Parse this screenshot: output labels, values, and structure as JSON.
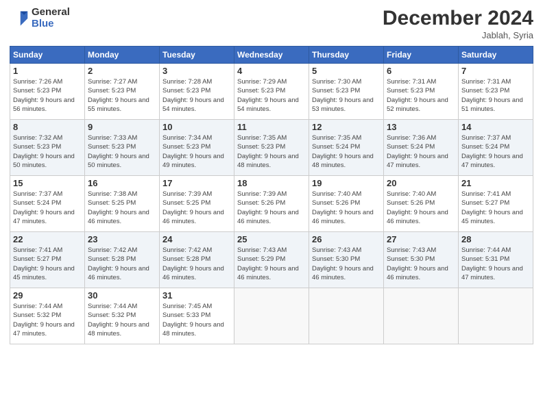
{
  "logo": {
    "line1": "General",
    "line2": "Blue"
  },
  "title": "December 2024",
  "subtitle": "Jablah, Syria",
  "days_header": [
    "Sunday",
    "Monday",
    "Tuesday",
    "Wednesday",
    "Thursday",
    "Friday",
    "Saturday"
  ],
  "weeks": [
    [
      {
        "num": "1",
        "sunrise": "Sunrise: 7:26 AM",
        "sunset": "Sunset: 5:23 PM",
        "daylight": "Daylight: 9 hours and 56 minutes."
      },
      {
        "num": "2",
        "sunrise": "Sunrise: 7:27 AM",
        "sunset": "Sunset: 5:23 PM",
        "daylight": "Daylight: 9 hours and 55 minutes."
      },
      {
        "num": "3",
        "sunrise": "Sunrise: 7:28 AM",
        "sunset": "Sunset: 5:23 PM",
        "daylight": "Daylight: 9 hours and 54 minutes."
      },
      {
        "num": "4",
        "sunrise": "Sunrise: 7:29 AM",
        "sunset": "Sunset: 5:23 PM",
        "daylight": "Daylight: 9 hours and 54 minutes."
      },
      {
        "num": "5",
        "sunrise": "Sunrise: 7:30 AM",
        "sunset": "Sunset: 5:23 PM",
        "daylight": "Daylight: 9 hours and 53 minutes."
      },
      {
        "num": "6",
        "sunrise": "Sunrise: 7:31 AM",
        "sunset": "Sunset: 5:23 PM",
        "daylight": "Daylight: 9 hours and 52 minutes."
      },
      {
        "num": "7",
        "sunrise": "Sunrise: 7:31 AM",
        "sunset": "Sunset: 5:23 PM",
        "daylight": "Daylight: 9 hours and 51 minutes."
      }
    ],
    [
      {
        "num": "8",
        "sunrise": "Sunrise: 7:32 AM",
        "sunset": "Sunset: 5:23 PM",
        "daylight": "Daylight: 9 hours and 50 minutes."
      },
      {
        "num": "9",
        "sunrise": "Sunrise: 7:33 AM",
        "sunset": "Sunset: 5:23 PM",
        "daylight": "Daylight: 9 hours and 50 minutes."
      },
      {
        "num": "10",
        "sunrise": "Sunrise: 7:34 AM",
        "sunset": "Sunset: 5:23 PM",
        "daylight": "Daylight: 9 hours and 49 minutes."
      },
      {
        "num": "11",
        "sunrise": "Sunrise: 7:35 AM",
        "sunset": "Sunset: 5:23 PM",
        "daylight": "Daylight: 9 hours and 48 minutes."
      },
      {
        "num": "12",
        "sunrise": "Sunrise: 7:35 AM",
        "sunset": "Sunset: 5:24 PM",
        "daylight": "Daylight: 9 hours and 48 minutes."
      },
      {
        "num": "13",
        "sunrise": "Sunrise: 7:36 AM",
        "sunset": "Sunset: 5:24 PM",
        "daylight": "Daylight: 9 hours and 47 minutes."
      },
      {
        "num": "14",
        "sunrise": "Sunrise: 7:37 AM",
        "sunset": "Sunset: 5:24 PM",
        "daylight": "Daylight: 9 hours and 47 minutes."
      }
    ],
    [
      {
        "num": "15",
        "sunrise": "Sunrise: 7:37 AM",
        "sunset": "Sunset: 5:24 PM",
        "daylight": "Daylight: 9 hours and 47 minutes."
      },
      {
        "num": "16",
        "sunrise": "Sunrise: 7:38 AM",
        "sunset": "Sunset: 5:25 PM",
        "daylight": "Daylight: 9 hours and 46 minutes."
      },
      {
        "num": "17",
        "sunrise": "Sunrise: 7:39 AM",
        "sunset": "Sunset: 5:25 PM",
        "daylight": "Daylight: 9 hours and 46 minutes."
      },
      {
        "num": "18",
        "sunrise": "Sunrise: 7:39 AM",
        "sunset": "Sunset: 5:26 PM",
        "daylight": "Daylight: 9 hours and 46 minutes."
      },
      {
        "num": "19",
        "sunrise": "Sunrise: 7:40 AM",
        "sunset": "Sunset: 5:26 PM",
        "daylight": "Daylight: 9 hours and 46 minutes."
      },
      {
        "num": "20",
        "sunrise": "Sunrise: 7:40 AM",
        "sunset": "Sunset: 5:26 PM",
        "daylight": "Daylight: 9 hours and 46 minutes."
      },
      {
        "num": "21",
        "sunrise": "Sunrise: 7:41 AM",
        "sunset": "Sunset: 5:27 PM",
        "daylight": "Daylight: 9 hours and 45 minutes."
      }
    ],
    [
      {
        "num": "22",
        "sunrise": "Sunrise: 7:41 AM",
        "sunset": "Sunset: 5:27 PM",
        "daylight": "Daylight: 9 hours and 45 minutes."
      },
      {
        "num": "23",
        "sunrise": "Sunrise: 7:42 AM",
        "sunset": "Sunset: 5:28 PM",
        "daylight": "Daylight: 9 hours and 46 minutes."
      },
      {
        "num": "24",
        "sunrise": "Sunrise: 7:42 AM",
        "sunset": "Sunset: 5:28 PM",
        "daylight": "Daylight: 9 hours and 46 minutes."
      },
      {
        "num": "25",
        "sunrise": "Sunrise: 7:43 AM",
        "sunset": "Sunset: 5:29 PM",
        "daylight": "Daylight: 9 hours and 46 minutes."
      },
      {
        "num": "26",
        "sunrise": "Sunrise: 7:43 AM",
        "sunset": "Sunset: 5:30 PM",
        "daylight": "Daylight: 9 hours and 46 minutes."
      },
      {
        "num": "27",
        "sunrise": "Sunrise: 7:43 AM",
        "sunset": "Sunset: 5:30 PM",
        "daylight": "Daylight: 9 hours and 46 minutes."
      },
      {
        "num": "28",
        "sunrise": "Sunrise: 7:44 AM",
        "sunset": "Sunset: 5:31 PM",
        "daylight": "Daylight: 9 hours and 47 minutes."
      }
    ],
    [
      {
        "num": "29",
        "sunrise": "Sunrise: 7:44 AM",
        "sunset": "Sunset: 5:32 PM",
        "daylight": "Daylight: 9 hours and 47 minutes."
      },
      {
        "num": "30",
        "sunrise": "Sunrise: 7:44 AM",
        "sunset": "Sunset: 5:32 PM",
        "daylight": "Daylight: 9 hours and 48 minutes."
      },
      {
        "num": "31",
        "sunrise": "Sunrise: 7:45 AM",
        "sunset": "Sunset: 5:33 PM",
        "daylight": "Daylight: 9 hours and 48 minutes."
      },
      null,
      null,
      null,
      null
    ]
  ]
}
